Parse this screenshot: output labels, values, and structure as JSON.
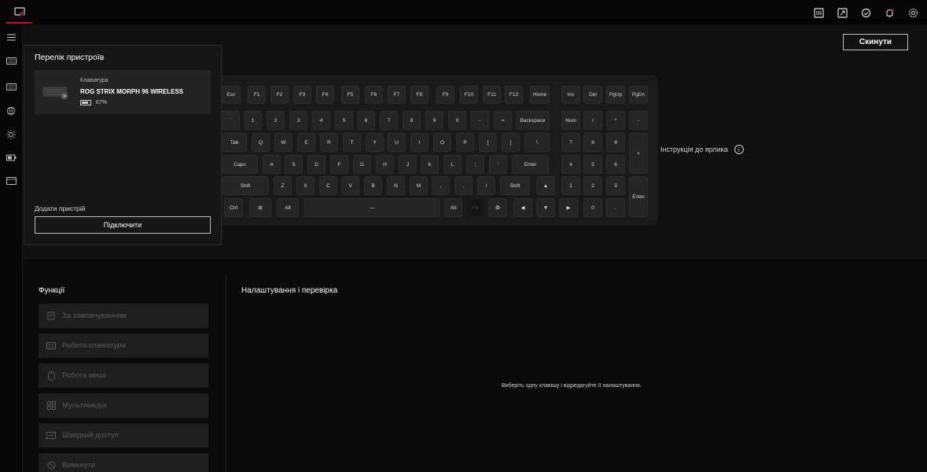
{
  "top_icons": [
    "macro-icon",
    "resize-icon",
    "sync-icon",
    "notification-icon",
    "settings-icon"
  ],
  "sidebar": {
    "items": [
      "menu-icon",
      "keyboard-icon",
      "keyboard-icon",
      "lighting-icon",
      "effects-icon",
      "battery-icon",
      "screen-icon"
    ]
  },
  "header": {
    "reset_label": "Скинути"
  },
  "device_list": {
    "title": "Перелік пристроїв",
    "device": {
      "type": "Клавіатура",
      "name": "ROG STRIX MORPH 96 WIRELESS",
      "battery": "67%",
      "battery_level": 0.67
    },
    "add_device_label": "Додати пристрій",
    "connect_label": "Підключити"
  },
  "keyboard": {
    "shortcut_guide": "Інструкція до ярлика",
    "info_symbol": "i",
    "row1": [
      "Esc",
      "F1",
      "F2",
      "F3",
      "F4",
      "F5",
      "F6",
      "F7",
      "F8",
      "F9",
      "F10",
      "F11",
      "F12",
      "Home",
      "Ins",
      "Del",
      "PgUp",
      "PgDn"
    ],
    "row2": [
      "`",
      "1",
      "2",
      "3",
      "4",
      "5",
      "6",
      "7",
      "8",
      "9",
      "0",
      "-",
      "=",
      "Backspace",
      "Num",
      "/",
      "*",
      "-"
    ],
    "row3": [
      "Tab",
      "Q",
      "W",
      "E",
      "R",
      "T",
      "Y",
      "U",
      "I",
      "O",
      "P",
      "[",
      "]",
      "\\",
      "7",
      "8",
      "9",
      "+"
    ],
    "row4": [
      "Caps",
      "A",
      "S",
      "D",
      "F",
      "G",
      "H",
      "J",
      "K",
      "L",
      ";",
      "'",
      "Enter",
      "4",
      "5",
      "6"
    ],
    "row5": [
      "Shift",
      "Z",
      "X",
      "C",
      "V",
      "B",
      "N",
      "M",
      ",",
      ".",
      "/",
      "Shift",
      "▲",
      "1",
      "2",
      "3",
      "Enter"
    ],
    "row6": [
      "Ctrl",
      "⊞",
      "Alt",
      "—",
      "Alt",
      "Fn",
      "❂",
      "◀",
      "▼",
      "▶",
      "0",
      "."
    ]
  },
  "functions": {
    "title": "Функції",
    "items": [
      {
        "label": "За замовчуванням",
        "icon": "default-icon"
      },
      {
        "label": "Робота клавіатури",
        "icon": "keyboard-icon"
      },
      {
        "label": "Робота миші",
        "icon": "mouse-icon"
      },
      {
        "label": "Мультимедіа",
        "icon": "multimedia-icon"
      },
      {
        "label": "Швидкий доступ",
        "icon": "shortcut-icon"
      },
      {
        "label": "Вимкнути",
        "icon": "disable-icon"
      }
    ]
  },
  "settings": {
    "title": "Налаштування і перевірка",
    "hint": "Виберіть одну клавішу і відредагуйте її налаштування."
  }
}
